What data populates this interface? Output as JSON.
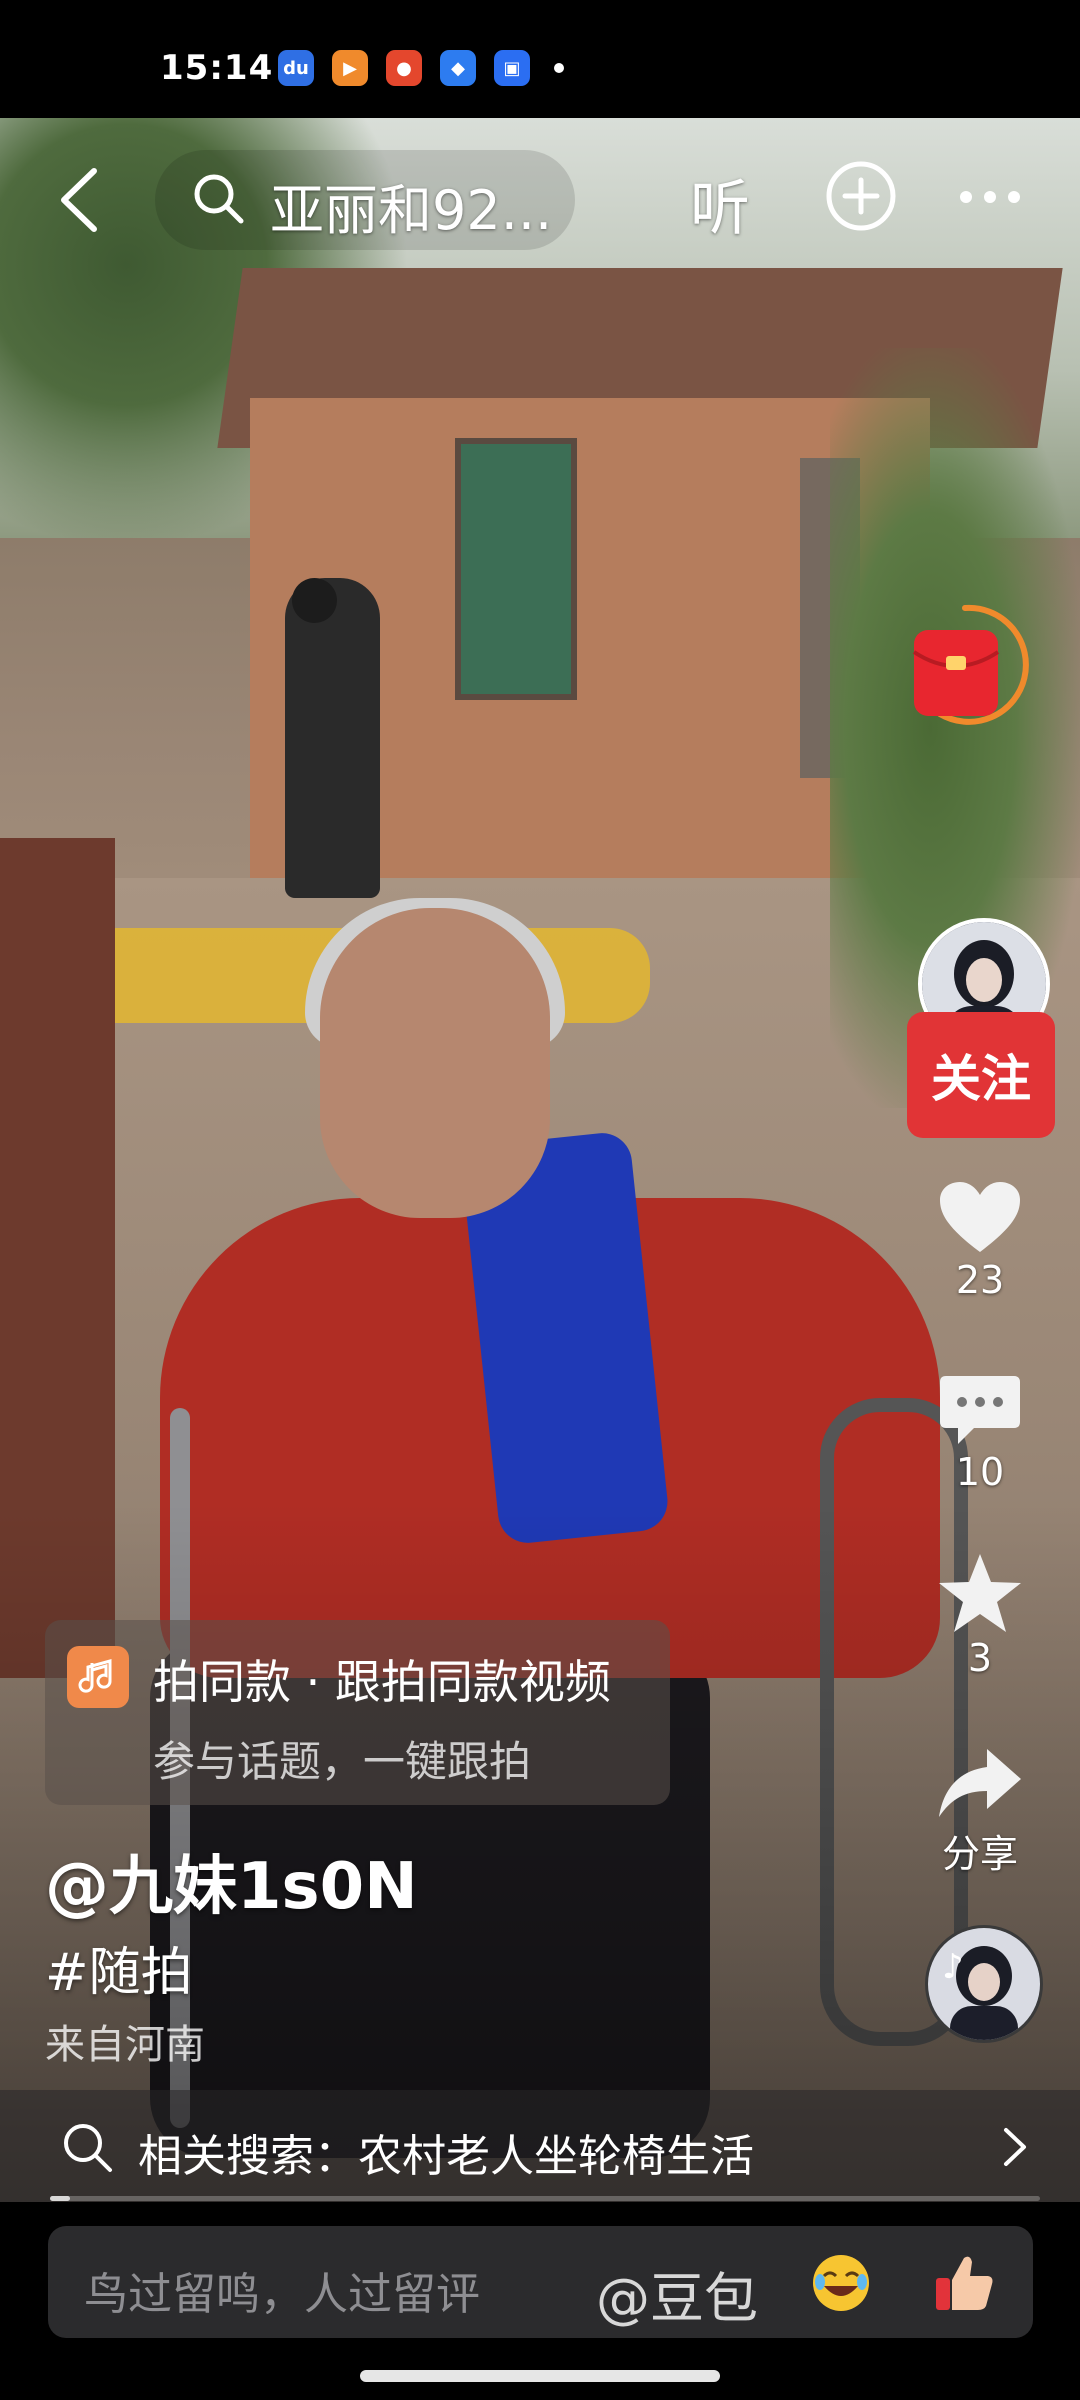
{
  "status_bar": {
    "time": "15:14",
    "app_icons": [
      {
        "name": "baidu-icon",
        "color": "#2f6fe4",
        "glyph": "du"
      },
      {
        "name": "video-app-icon",
        "color": "#f08a2c",
        "glyph": "▶"
      },
      {
        "name": "toutiao-icon",
        "color": "#e4472d",
        "glyph": "●"
      },
      {
        "name": "browser-icon",
        "color": "#2d7cf0",
        "glyph": "◆"
      },
      {
        "name": "wallet-icon",
        "color": "#2b6ef2",
        "glyph": "▣"
      }
    ]
  },
  "top_nav": {
    "search_query": "亚丽和92...",
    "listen_label": "听"
  },
  "actions": {
    "likes": "23",
    "comments": "10",
    "favorites": "3",
    "share_label": "分享",
    "follow_label": "关注"
  },
  "same_style": {
    "title": "拍同款 · 跟拍同款视频",
    "subtitle": "参与话题，一键跟拍"
  },
  "post": {
    "author": "@九妹1s0N",
    "hashtag": "#随拍",
    "location": "来自河南"
  },
  "related": {
    "label": "相关搜索：农村老人坐轮椅生活"
  },
  "progress": {
    "fraction": 0.02
  },
  "comment": {
    "placeholder": "鸟过留鸣，人过留评",
    "mention": "@豆包"
  },
  "colors": {
    "follow_red": "#e13436",
    "music_orange": "#f0894a"
  }
}
